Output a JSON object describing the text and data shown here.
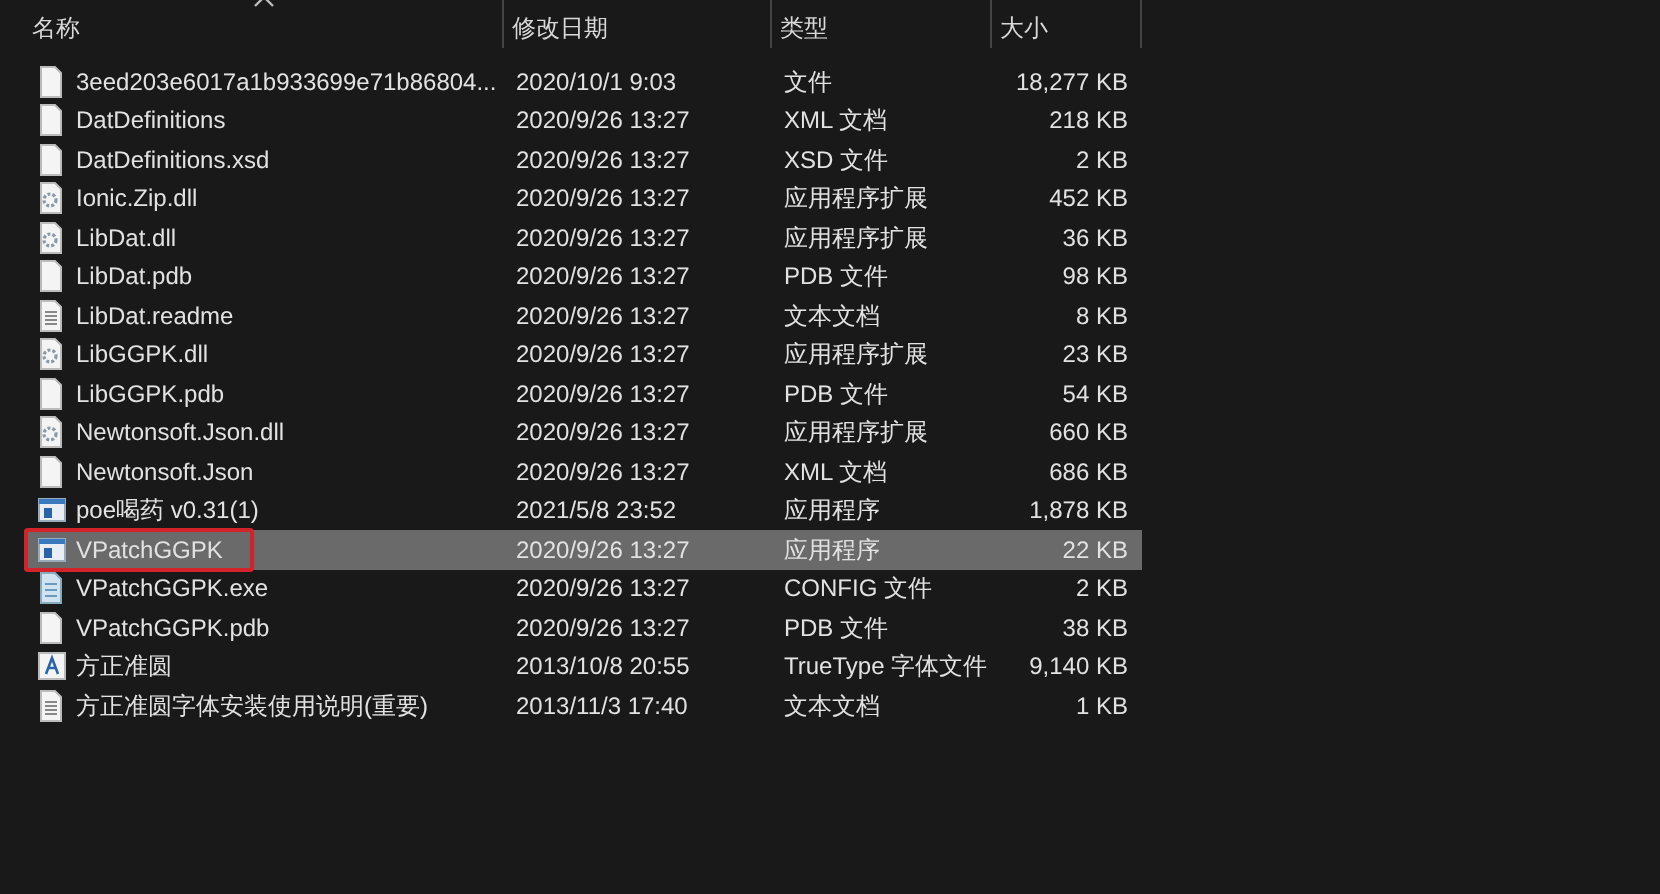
{
  "columns": [
    {
      "label": "名称",
      "sorted": true
    },
    {
      "label": "修改日期",
      "sorted": false
    },
    {
      "label": "类型",
      "sorted": false
    },
    {
      "label": "大小",
      "sorted": false
    }
  ],
  "rows": [
    {
      "name": "3eed203e6017a1b933699e71b86804...",
      "date": "2020/10/1 9:03",
      "type": "文件",
      "size": "18,277 KB",
      "kind": "file",
      "selected": false,
      "marked": false
    },
    {
      "name": "DatDefinitions",
      "date": "2020/9/26 13:27",
      "type": "XML 文档",
      "size": "218 KB",
      "kind": "file",
      "selected": false,
      "marked": false
    },
    {
      "name": "DatDefinitions.xsd",
      "date": "2020/9/26 13:27",
      "type": "XSD 文件",
      "size": "2 KB",
      "kind": "file",
      "selected": false,
      "marked": false
    },
    {
      "name": "Ionic.Zip.dll",
      "date": "2020/9/26 13:27",
      "type": "应用程序扩展",
      "size": "452 KB",
      "kind": "dll",
      "selected": false,
      "marked": false
    },
    {
      "name": "LibDat.dll",
      "date": "2020/9/26 13:27",
      "type": "应用程序扩展",
      "size": "36 KB",
      "kind": "dll",
      "selected": false,
      "marked": false
    },
    {
      "name": "LibDat.pdb",
      "date": "2020/9/26 13:27",
      "type": "PDB 文件",
      "size": "98 KB",
      "kind": "file",
      "selected": false,
      "marked": false
    },
    {
      "name": "LibDat.readme",
      "date": "2020/9/26 13:27",
      "type": "文本文档",
      "size": "8 KB",
      "kind": "text",
      "selected": false,
      "marked": false
    },
    {
      "name": "LibGGPK.dll",
      "date": "2020/9/26 13:27",
      "type": "应用程序扩展",
      "size": "23 KB",
      "kind": "dll",
      "selected": false,
      "marked": false
    },
    {
      "name": "LibGGPK.pdb",
      "date": "2020/9/26 13:27",
      "type": "PDB 文件",
      "size": "54 KB",
      "kind": "file",
      "selected": false,
      "marked": false
    },
    {
      "name": "Newtonsoft.Json.dll",
      "date": "2020/9/26 13:27",
      "type": "应用程序扩展",
      "size": "660 KB",
      "kind": "dll",
      "selected": false,
      "marked": false
    },
    {
      "name": "Newtonsoft.Json",
      "date": "2020/9/26 13:27",
      "type": "XML 文档",
      "size": "686 KB",
      "kind": "file",
      "selected": false,
      "marked": false
    },
    {
      "name": "poe喝药 v0.31(1)",
      "date": "2021/5/8 23:52",
      "type": "应用程序",
      "size": "1,878 KB",
      "kind": "app",
      "selected": false,
      "marked": false
    },
    {
      "name": "VPatchGGPK",
      "date": "2020/9/26 13:27",
      "type": "应用程序",
      "size": "22 KB",
      "kind": "app",
      "selected": true,
      "marked": true
    },
    {
      "name": "VPatchGGPK.exe",
      "date": "2020/9/26 13:27",
      "type": "CONFIG 文件",
      "size": "2 KB",
      "kind": "config",
      "selected": false,
      "marked": false
    },
    {
      "name": "VPatchGGPK.pdb",
      "date": "2020/9/26 13:27",
      "type": "PDB 文件",
      "size": "38 KB",
      "kind": "file",
      "selected": false,
      "marked": false
    },
    {
      "name": "方正准圆",
      "date": "2013/10/8 20:55",
      "type": "TrueType 字体文件",
      "size": "9,140 KB",
      "kind": "font",
      "selected": false,
      "marked": false
    },
    {
      "name": "方正准圆字体安装使用说明(重要)",
      "date": "2013/11/3 17:40",
      "type": "文本文档",
      "size": "1 KB",
      "kind": "text",
      "selected": false,
      "marked": false
    }
  ]
}
